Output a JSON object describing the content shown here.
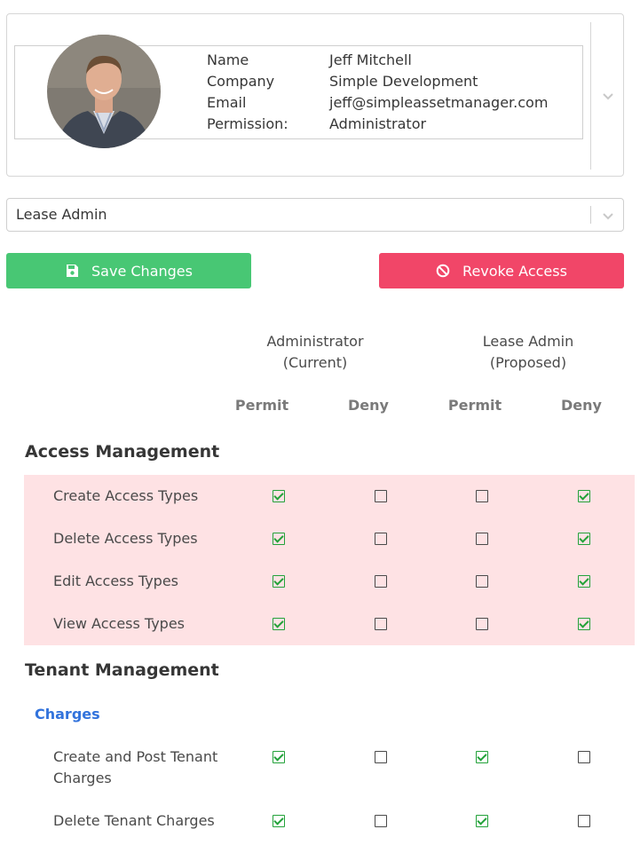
{
  "user": {
    "labels": {
      "name": "Name",
      "company": "Company",
      "email": "Email",
      "permission": "Permission:"
    },
    "values": {
      "name": "Jeff Mitchell",
      "company": "Simple Development",
      "email": "jeff@simpleassetmanager.com",
      "permission": "Administrator"
    }
  },
  "role_select": {
    "value": "Lease Admin"
  },
  "actions": {
    "save_label": "Save Changes",
    "revoke_label": "Revoke Access"
  },
  "columns": {
    "current": {
      "line1": "Administrator",
      "line2": "(Current)"
    },
    "proposed": {
      "line1": "Lease Admin",
      "line2": "(Proposed)"
    },
    "permit": "Permit",
    "deny": "Deny"
  },
  "sections": [
    {
      "title": "Access Management",
      "rows": [
        {
          "label": "Create Access Types",
          "current_permit": true,
          "current_deny": false,
          "proposed_permit": false,
          "proposed_deny": true
        },
        {
          "label": "Delete Access Types",
          "current_permit": true,
          "current_deny": false,
          "proposed_permit": false,
          "proposed_deny": true
        },
        {
          "label": "Edit Access Types",
          "current_permit": true,
          "current_deny": false,
          "proposed_permit": false,
          "proposed_deny": true
        },
        {
          "label": "View Access Types",
          "current_permit": true,
          "current_deny": false,
          "proposed_permit": false,
          "proposed_deny": true
        }
      ]
    },
    {
      "title": "Tenant Management",
      "subgroup": "Charges",
      "rows": [
        {
          "label": "Create and Post Tenant Charges",
          "current_permit": true,
          "current_deny": false,
          "proposed_permit": true,
          "proposed_deny": false
        },
        {
          "label": "Delete Tenant Charges",
          "current_permit": true,
          "current_deny": false,
          "proposed_permit": true,
          "proposed_deny": false
        }
      ]
    }
  ],
  "colors": {
    "save": "#48c774",
    "revoke": "#f14668",
    "highlight": "#fee2e4",
    "link": "#3273dc",
    "check": "#23a23a"
  },
  "icons": {
    "save": "floppy-disk-icon",
    "revoke": "ban-icon",
    "chevron": "chevron-down-icon"
  }
}
